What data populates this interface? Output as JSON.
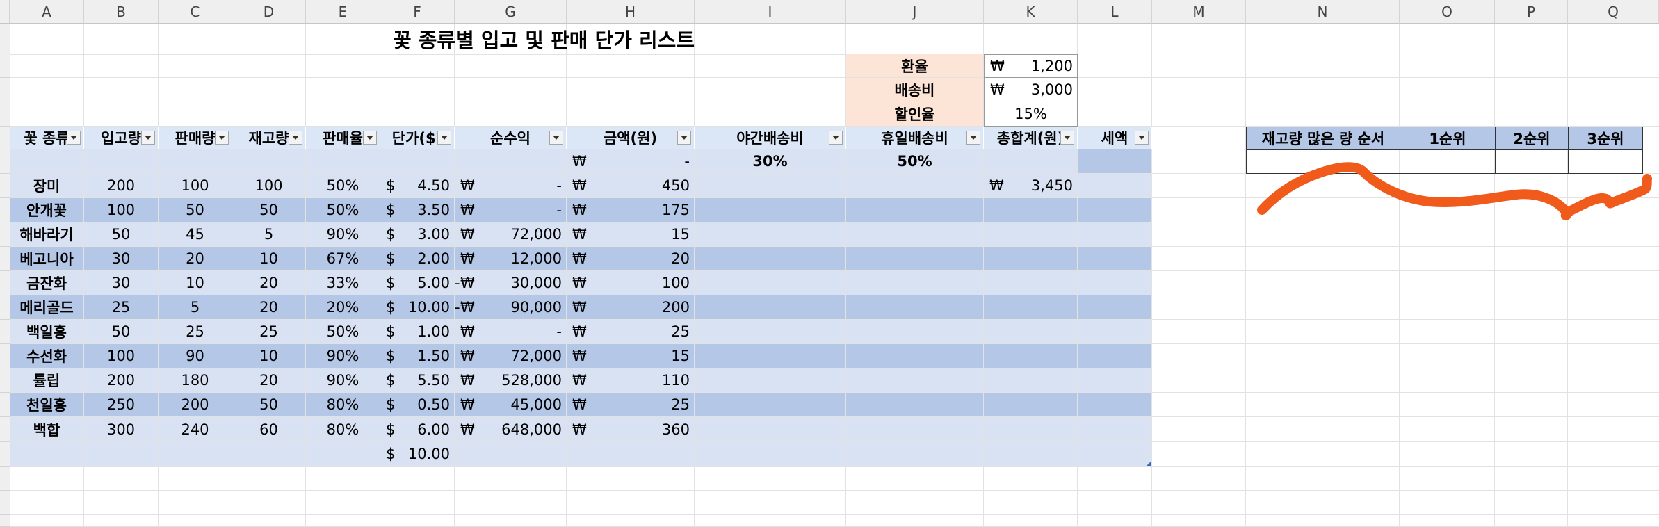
{
  "columns": [
    "A",
    "B",
    "C",
    "D",
    "E",
    "F",
    "G",
    "H",
    "I",
    "J",
    "K",
    "L",
    "M",
    "N",
    "O",
    "P",
    "Q"
  ],
  "title": "꽃 종류별 입고 및 판매 단가 리스트",
  "params": {
    "exchange_label": "환율",
    "exchange_cur": "₩",
    "exchange_value": "1,200",
    "shipping_label": "배송비",
    "shipping_cur": "₩",
    "shipping_value": "3,000",
    "discount_label": "할인율",
    "discount_value": "15%"
  },
  "table_headers": [
    "꽃 종류",
    "입고량",
    "판매량",
    "재고량",
    "판매율",
    "단가($)",
    "순수익",
    "금액(원)",
    "야간배송비",
    "휴일배송비",
    "총합계(원)",
    "세액"
  ],
  "subheader": {
    "h_cur": "₩",
    "h_val": "-",
    "night": "30%",
    "holiday": "50%"
  },
  "rows": [
    {
      "name": "장미",
      "in": "200",
      "sold": "100",
      "stock": "100",
      "rate": "50%",
      "price": "4.50",
      "g_neg": "",
      "profit": "-",
      "amount": "450",
      "total_cur": "₩",
      "total": "3,450"
    },
    {
      "name": "안개꽃",
      "in": "100",
      "sold": "50",
      "stock": "50",
      "rate": "50%",
      "price": "3.50",
      "g_neg": "",
      "profit": "-",
      "amount": "175",
      "total_cur": "",
      "total": ""
    },
    {
      "name": "해바라기",
      "in": "50",
      "sold": "45",
      "stock": "5",
      "rate": "90%",
      "price": "3.00",
      "g_neg": "",
      "profit": "72,000",
      "amount": "15",
      "total_cur": "",
      "total": ""
    },
    {
      "name": "베고니아",
      "in": "30",
      "sold": "20",
      "stock": "10",
      "rate": "67%",
      "price": "2.00",
      "g_neg": "",
      "profit": "12,000",
      "amount": "20",
      "total_cur": "",
      "total": ""
    },
    {
      "name": "금잔화",
      "in": "30",
      "sold": "10",
      "stock": "20",
      "rate": "33%",
      "price": "5.00",
      "g_neg": "-",
      "profit": "30,000",
      "amount": "100",
      "total_cur": "",
      "total": ""
    },
    {
      "name": "메리골드",
      "in": "25",
      "sold": "5",
      "stock": "20",
      "rate": "20%",
      "price": "10.00",
      "g_neg": "-",
      "profit": "90,000",
      "amount": "200",
      "total_cur": "",
      "total": ""
    },
    {
      "name": "백일홍",
      "in": "50",
      "sold": "25",
      "stock": "25",
      "rate": "50%",
      "price": "1.00",
      "g_neg": "",
      "profit": "-",
      "amount": "25",
      "total_cur": "",
      "total": ""
    },
    {
      "name": "수선화",
      "in": "100",
      "sold": "90",
      "stock": "10",
      "rate": "90%",
      "price": "1.50",
      "g_neg": "",
      "profit": "72,000",
      "amount": "15",
      "total_cur": "",
      "total": ""
    },
    {
      "name": "튤립",
      "in": "200",
      "sold": "180",
      "stock": "20",
      "rate": "90%",
      "price": "5.50",
      "g_neg": "",
      "profit": "528,000",
      "amount": "110",
      "total_cur": "",
      "total": ""
    },
    {
      "name": "천일홍",
      "in": "250",
      "sold": "200",
      "stock": "50",
      "rate": "80%",
      "price": "0.50",
      "g_neg": "",
      "profit": "45,000",
      "amount": "25",
      "total_cur": "",
      "total": ""
    },
    {
      "name": "백합",
      "in": "300",
      "sold": "240",
      "stock": "60",
      "rate": "80%",
      "price": "6.00",
      "g_neg": "",
      "profit": "648,000",
      "amount": "360",
      "total_cur": "",
      "total": ""
    }
  ],
  "total_row": {
    "price": "10.00"
  },
  "currency_dollar": "$",
  "currency_won": "₩",
  "ranking": {
    "label": "재고량 많은 량 순서",
    "r1": "1순위",
    "r2": "2순위",
    "r3": "3순위"
  },
  "annotation": {
    "color": "#f05a1a",
    "shape": "hand-drawn-wavy-line"
  }
}
